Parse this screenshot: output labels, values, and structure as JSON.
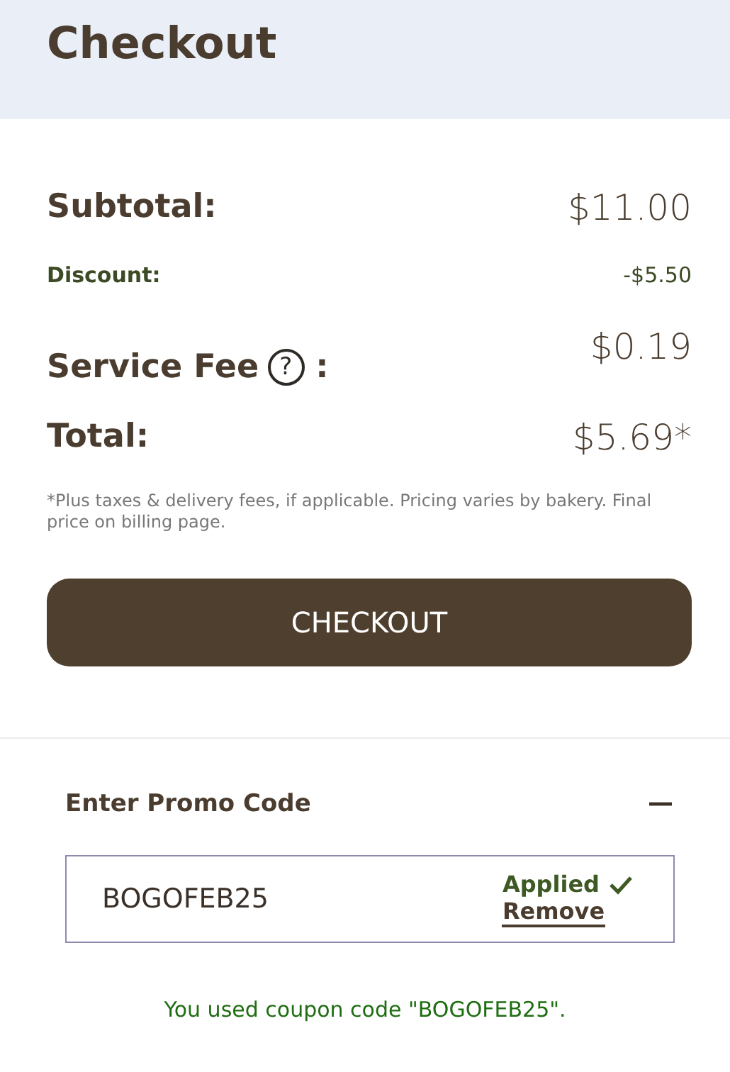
{
  "header": {
    "title": "Checkout"
  },
  "summary": [
    {
      "kind": "main",
      "label": "Subtotal:",
      "value": "$11.00"
    },
    {
      "kind": "discount",
      "label": "Discount:",
      "value": "-$5.50"
    },
    {
      "kind": "fee",
      "label": "Service Fee",
      "suffix": ":",
      "value": "$0.19",
      "help": "?"
    },
    {
      "kind": "main",
      "label": "Total:",
      "value": "$5.69*"
    }
  ],
  "note": "*Plus taxes & delivery fees, if applicable. Pricing varies by bakery. Final price on billing page.",
  "checkout_button": "CHECKOUT",
  "promo": {
    "title": "Enter Promo Code",
    "expanded": true,
    "value": "BOGOFEB25",
    "status": "Applied",
    "applied": true,
    "remove": "Remove",
    "message": "You used coupon code \"BOGOFEB25\"."
  }
}
